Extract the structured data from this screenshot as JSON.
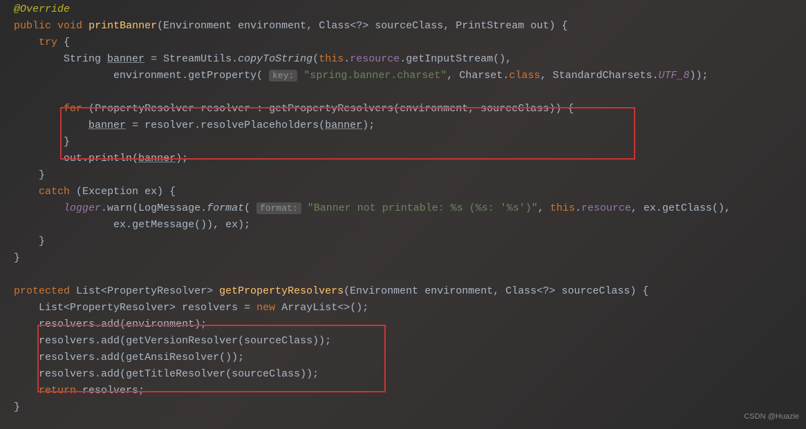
{
  "code": {
    "line1_annotation": "@Override",
    "line2_public": "public",
    "line2_void": "void",
    "line2_method": "printBanner",
    "line2_env_type": "Environment",
    "line2_env_param": "environment",
    "line2_class_type": "Class",
    "line2_generic": "<?>",
    "line2_sourceclass": "sourceClass",
    "line2_printstream": "PrintStream",
    "line2_out": "out",
    "line3_try": "try",
    "line4_string": "String",
    "line4_banner": "banner",
    "line4_streamutils": "StreamUtils",
    "line4_copytostring": "copyToString",
    "line4_this": "this",
    "line4_resource": "resource",
    "line4_getinputstream": "getInputStream",
    "line5_environment": "environment",
    "line5_getproperty": "getProperty",
    "line5_keyhint": "key:",
    "line5_string1": "\"spring.banner.charset\"",
    "line5_charset": "Charset",
    "line5_class": "class",
    "line5_standardcharsets": "StandardCharsets",
    "line5_utf8": "UTF_8",
    "line7_for": "for",
    "line7_propres": "PropertyResolver",
    "line7_resolver": "resolver",
    "line7_getpropresolvers": "getPropertyResolvers",
    "line7_env": "environment",
    "line7_srcclass": "sourceClass",
    "line8_banner": "banner",
    "line8_resolver": "resolver",
    "line8_resolveplaceholders": "resolvePlaceholders",
    "line8_banner2": "banner",
    "line10_out": "out",
    "line10_println": "println",
    "line10_banner": "banner",
    "line12_catch": "catch",
    "line12_exception": "Exception",
    "line12_ex": "ex",
    "line13_logger": "logger",
    "line13_warn": "warn",
    "line13_logmessage": "LogMessage",
    "line13_format": "format",
    "line13_formathint": "format:",
    "line13_string": "\"Banner not printable: %s (%s: '%s')\"",
    "line13_this": "this",
    "line13_resource": "resource",
    "line13_ex": "ex",
    "line13_getclass": "getClass",
    "line14_ex": "ex",
    "line14_getmessage": "getMessage",
    "line14_ex2": "ex",
    "line18_protected": "protected",
    "line18_list": "List",
    "line18_propres": "PropertyResolver",
    "line18_method": "getPropertyResolvers",
    "line18_envtype": "Environment",
    "line18_env": "environment",
    "line18_classtype": "Class",
    "line18_generic": "<?>",
    "line18_srcclass": "sourceClass",
    "line19_list": "List",
    "line19_propres": "PropertyResolver",
    "line19_resolvers": "resolvers",
    "line19_new": "new",
    "line19_arraylist": "ArrayList",
    "line19_diamond": "<>",
    "line20_resolvers": "resolvers",
    "line20_add": "add",
    "line20_env": "environment",
    "line21_resolvers": "resolvers",
    "line21_add": "add",
    "line21_getversion": "getVersionResolver",
    "line21_srcclass": "sourceClass",
    "line22_resolvers": "resolvers",
    "line22_add": "add",
    "line22_getansi": "getAnsiResolver",
    "line23_resolvers": "resolvers",
    "line23_add": "add",
    "line23_gettitle": "getTitleResolver",
    "line23_srcclass": "sourceClass",
    "line24_return": "return",
    "line24_resolvers": "resolvers"
  },
  "watermark": "CSDN @Huazie"
}
